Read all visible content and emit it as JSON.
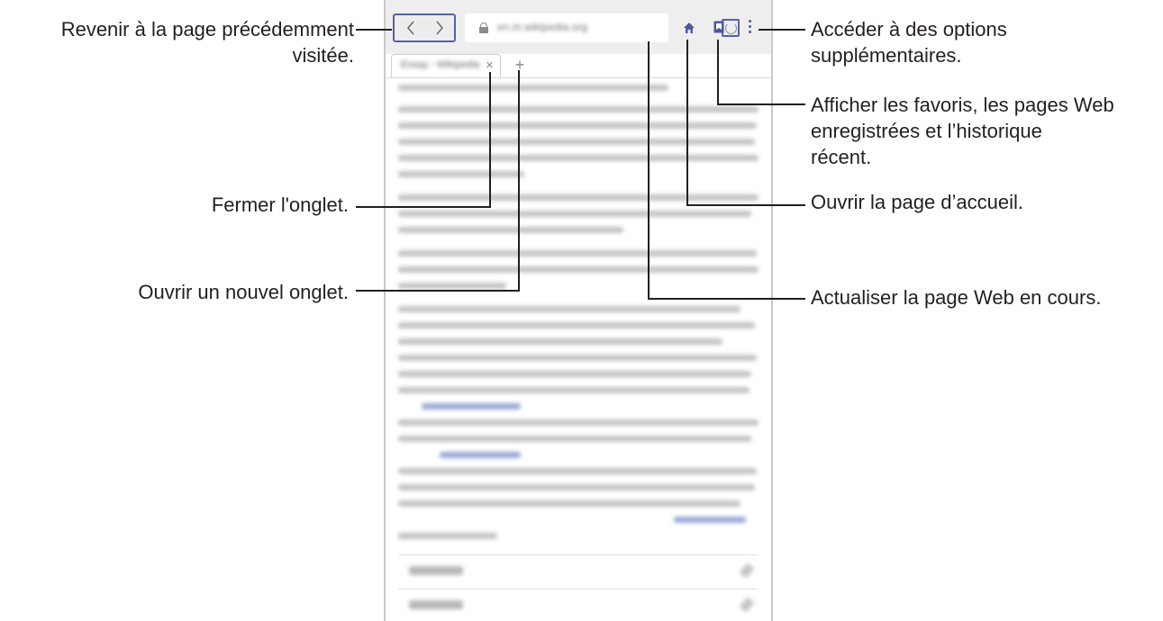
{
  "browser": {
    "url": "en.m.wikipedia.org",
    "tab_title": "Essay - Wikipedia",
    "tab_close_glyph": "×",
    "new_tab_glyph": "+",
    "back_glyph": "‹",
    "forward_glyph": "›",
    "icons": {
      "back": "chevron-left-icon",
      "forward": "chevron-right-icon",
      "lock": "lock-icon",
      "reload": "reload-icon",
      "home": "home-icon",
      "bookmarks": "bookmark-icon",
      "more": "more-options-icon"
    },
    "accent_color": "#4d56a0"
  },
  "callouts": {
    "back_forward": "Revenir à la page précédemment\nvisitée.",
    "close_tab": "Fermer l'onglet.",
    "new_tab": "Ouvrir un nouvel onglet.",
    "more_options": "Accéder à des options\nsupplémentaires.",
    "bookmarks": "Afficher les favoris, les pages Web\nenregistrées et l’historique\nrécent.",
    "home": "Ouvrir la page d’accueil.",
    "reload": "Actualiser la page Web en cours."
  }
}
